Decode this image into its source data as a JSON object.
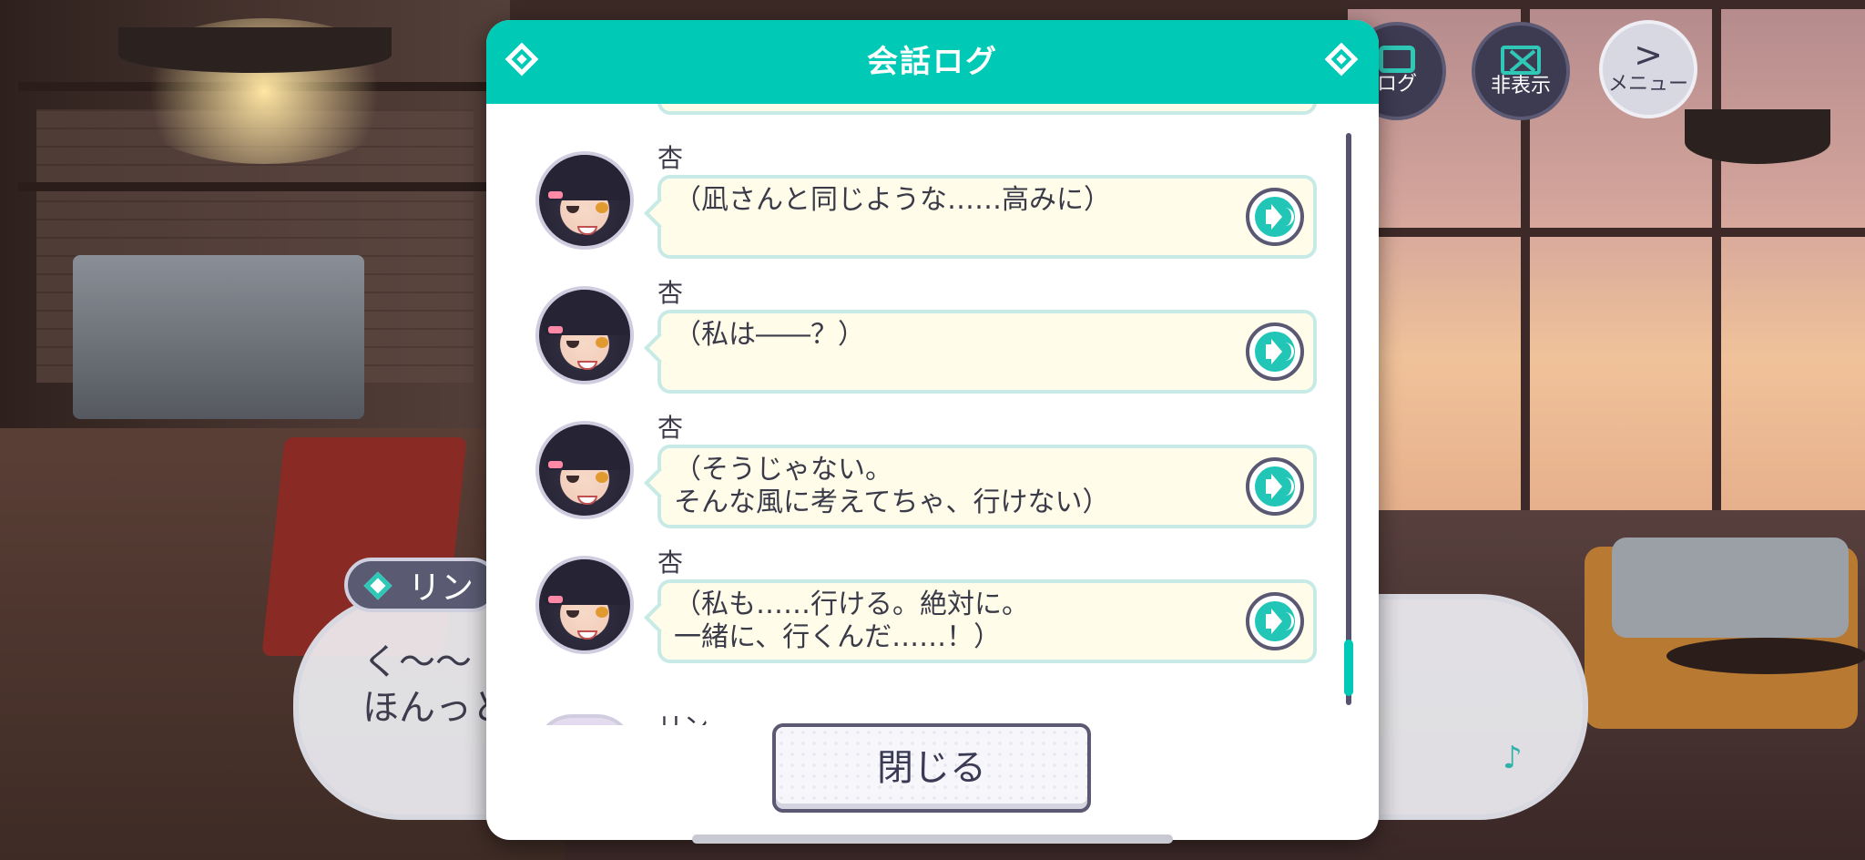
{
  "modal": {
    "title": "会話ログ",
    "close_label": "閉じる",
    "partial_speaker": "リン"
  },
  "entries": [
    {
      "speaker": "杏",
      "text": "（凪さんと同じような……高みに）"
    },
    {
      "speaker": "杏",
      "text": "（私は――？）"
    },
    {
      "speaker": "杏",
      "text": "（そうじゃない。\nそんな風に考えてちゃ、行けない）"
    },
    {
      "speaker": "杏",
      "text": "（私も……行ける。絶対に。\n一緒に、行くんだ……！）"
    }
  ],
  "hud": {
    "log_label": "ログ",
    "hide_label": "非表示",
    "menu_label": "メニュー",
    "menu_icon": ">"
  },
  "background_dialog": {
    "speaker": "リン",
    "line1": "く～～",
    "line2": "ほんっと"
  },
  "colors": {
    "accent": "#00c9b6",
    "bubble_fill": "#fffdea",
    "bubble_border": "#c8eae6",
    "text": "#3a3a48",
    "outline": "#5a5872"
  },
  "icons": {
    "voice": "speaker-icon",
    "header": "diamond-icon",
    "hud_log": "chat-icon",
    "hud_hide": "hide-icon",
    "hud_menu": "chevron-right-icon",
    "note": "music-note-icon"
  }
}
